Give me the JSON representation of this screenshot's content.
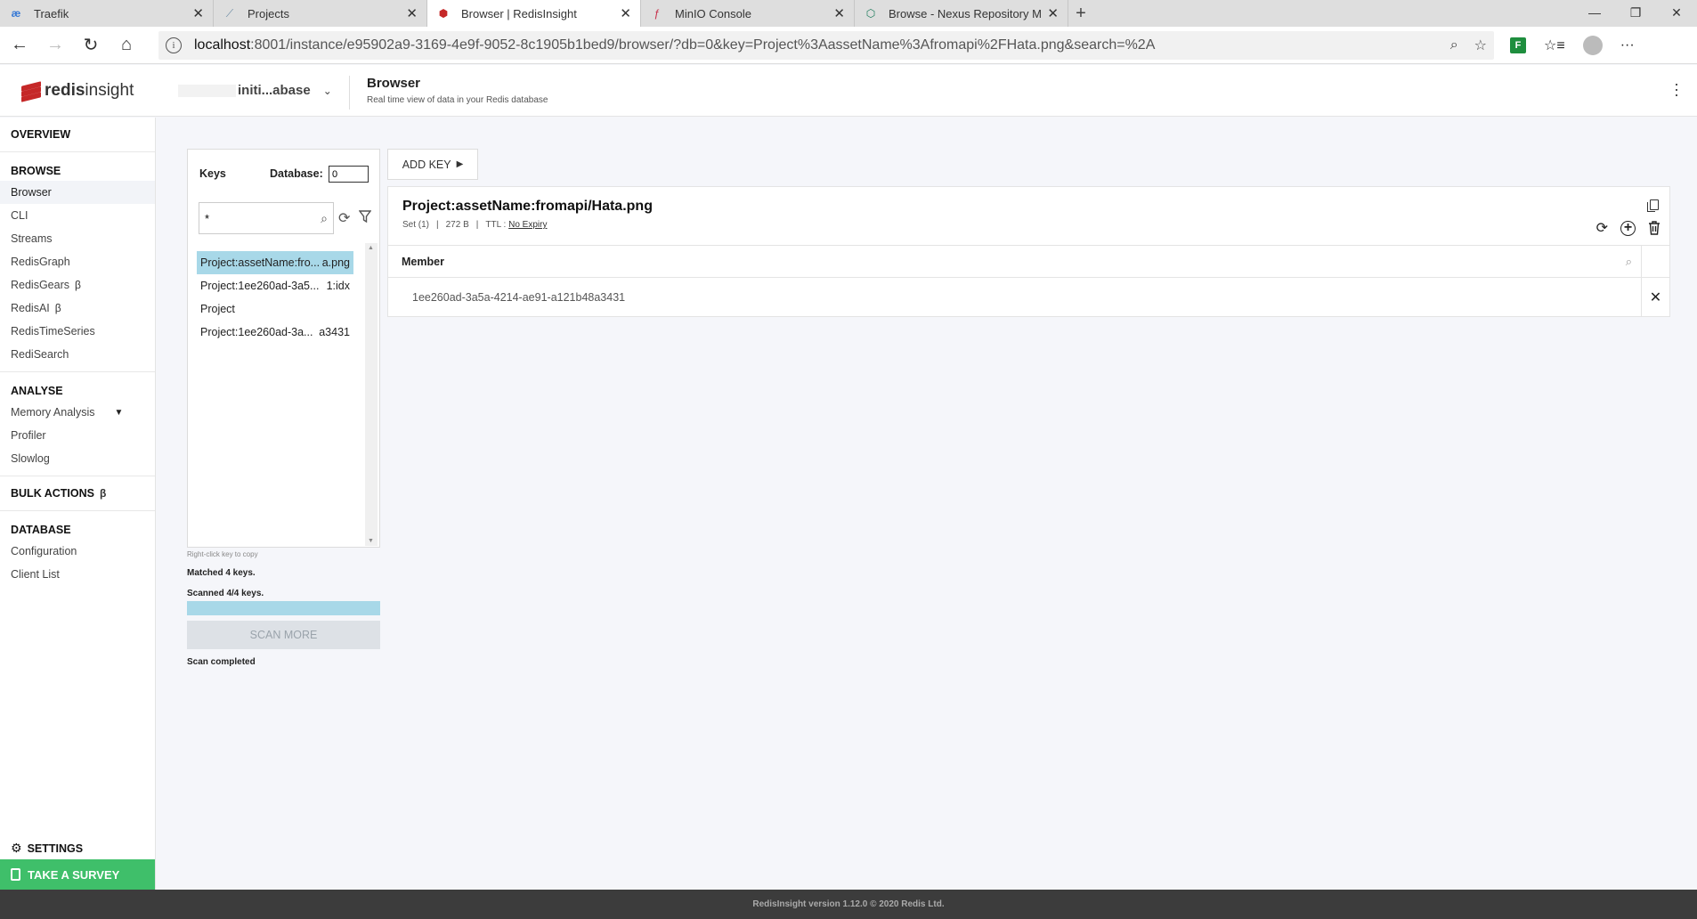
{
  "browser": {
    "tabs": [
      {
        "label": "Traefik",
        "icon": "traefik-icon"
      },
      {
        "label": "Projects",
        "icon": "projects-icon"
      },
      {
        "label": "Browser | RedisInsight",
        "icon": "redis-icon",
        "active": true
      },
      {
        "label": "MinIO Console",
        "icon": "minio-icon"
      },
      {
        "label": "Browse - Nexus Repository Mana",
        "icon": "nexus-icon"
      }
    ],
    "url_host": "localhost",
    "url_rest": ":8001/instance/e95902a9-3169-4e9f-9052-8c1905b1bed9/browser/?db=0&key=Project%3AassetName%3Afromapi%2FHata.png&search=%2A"
  },
  "header": {
    "logo_bold": "redis",
    "logo_light": "insight",
    "db_name": "initi...abase",
    "page_title": "Browser",
    "page_subtitle": "Real time view of data in your Redis database"
  },
  "sidebar": {
    "overview": "OVERVIEW",
    "browse": {
      "heading": "BROWSE",
      "items": [
        {
          "label": "Browser"
        },
        {
          "label": "CLI"
        },
        {
          "label": "Streams"
        },
        {
          "label": "RedisGraph"
        },
        {
          "label": "RedisGears",
          "beta": "β"
        },
        {
          "label": "RedisAI",
          "beta": "β"
        },
        {
          "label": "RedisTimeSeries"
        },
        {
          "label": "RediSearch"
        }
      ]
    },
    "analyse": {
      "heading": "ANALYSE",
      "items": [
        {
          "label": "Memory Analysis"
        },
        {
          "label": "Profiler"
        },
        {
          "label": "Slowlog"
        }
      ]
    },
    "bulk_actions": "BULK ACTIONS",
    "bulk_beta": "β",
    "database": {
      "heading": "DATABASE",
      "items": [
        {
          "label": "Configuration"
        },
        {
          "label": "Client List"
        }
      ]
    },
    "settings": "SETTINGS",
    "survey": "TAKE A SURVEY"
  },
  "keys_panel": {
    "title": "Keys",
    "database_label": "Database:",
    "database_value": "0",
    "search_value": "*",
    "keys": [
      {
        "left": "Project:assetName:fro...",
        "right": "a.png",
        "selected": true
      },
      {
        "left": "Project:1ee260ad-3a5...",
        "right": "1:idx"
      },
      {
        "left": "Project",
        "right": ""
      },
      {
        "left": "Project:1ee260ad-3a...",
        "right": "a3431"
      }
    ],
    "hint": "Right-click key to copy",
    "matched": "Matched 4 keys.",
    "scanned": "Scanned 4/4 keys.",
    "scan_progress_percent": 100,
    "scan_more": "SCAN MORE",
    "scan_status": "Scan completed"
  },
  "add_key": "ADD KEY",
  "key_detail": {
    "name": "Project:assetName:fromapi/Hata.png",
    "type": "Set (1)",
    "size": "272 B",
    "ttl_label": "TTL :",
    "ttl_value": "No Expiry",
    "column_header": "Member",
    "members": [
      "1ee260ad-3a5a-4214-ae91-a121b48a3431"
    ]
  },
  "footer": "RedisInsight version 1.12.0 © 2020 Redis Ltd."
}
